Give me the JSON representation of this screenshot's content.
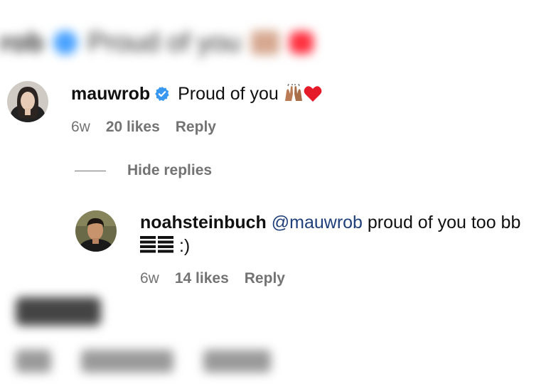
{
  "blurred_context": {
    "top_comment_obscured": true,
    "bottom_comment_obscured": true
  },
  "comment": {
    "username": "mauwrob",
    "verified": true,
    "text": "Proud of you",
    "emojis": [
      "raising-hands-icon",
      "red-heart-icon"
    ],
    "age": "6w",
    "likes": "20 likes",
    "reply_label": "Reply"
  },
  "replies_toggle": {
    "label": "Hide replies"
  },
  "reply": {
    "username": "noahsteinbuch",
    "mention": "@mauwrob",
    "text": "proud of you too bb",
    "trailing": ":)",
    "age": "6w",
    "likes": "14 likes",
    "reply_label": "Reply"
  },
  "colors": {
    "verified_badge": "#3897f0",
    "mention": "#1f3f7a",
    "meta_gray": "#737373"
  }
}
